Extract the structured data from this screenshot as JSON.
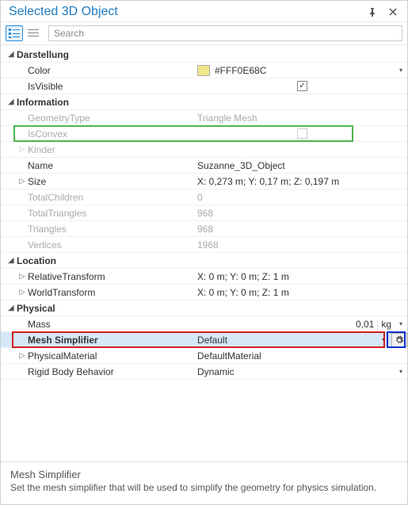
{
  "header": {
    "title": "Selected 3D Object"
  },
  "search": {
    "placeholder": "Search"
  },
  "cats": {
    "appearance": "Darstellung",
    "information": "Information",
    "location": "Location",
    "physical": "Physical"
  },
  "appearance": {
    "color_label": "Color",
    "color_value": "#FFF0E68C",
    "color_swatch": "#F0E68C",
    "isvisible_label": "IsVisible",
    "isvisible_checked": true
  },
  "information": {
    "geometrytype_label": "GeometryType",
    "geometrytype_value": "Triangle Mesh",
    "isconvex_label": "IsConvex",
    "isconvex_checked": false,
    "kinder_label": "Kinder",
    "name_label": "Name",
    "name_value": "Suzanne_3D_Object",
    "size_label": "Size",
    "size_value": "X: 0,273 m; Y: 0,17 m; Z: 0,197 m",
    "totalchildren_label": "TotalChildren",
    "totalchildren_value": "0",
    "totaltriangles_label": "TotalTriangles",
    "totaltriangles_value": "968",
    "triangles_label": "Triangles",
    "triangles_value": "968",
    "vertices_label": "Vertices",
    "vertices_value": "1968"
  },
  "location": {
    "relative_label": "RelativeTransform",
    "relative_value": "X: 0 m; Y: 0 m; Z: 1 m",
    "world_label": "WorldTransform",
    "world_value": "X: 0 m; Y: 0 m; Z: 1 m"
  },
  "physical": {
    "mass_label": "Mass",
    "mass_value": "0,01",
    "mass_unit": "kg",
    "meshsimp_label": "Mesh Simplifier",
    "meshsimp_value": "Default",
    "physmat_label": "PhysicalMaterial",
    "physmat_value": "DefaultMaterial",
    "rigidbody_label": "Rigid Body Behavior",
    "rigidbody_value": "Dynamic"
  },
  "description": {
    "title": "Mesh Simplifier",
    "text": "Set the mesh simplifier that will be used to simplify the geometry for physics simulation."
  },
  "glyphs": {
    "expand_open": "◢",
    "expand_closed": "▷",
    "check": "✓",
    "dd": "▾",
    "pin": "⊥",
    "close": "✕"
  }
}
